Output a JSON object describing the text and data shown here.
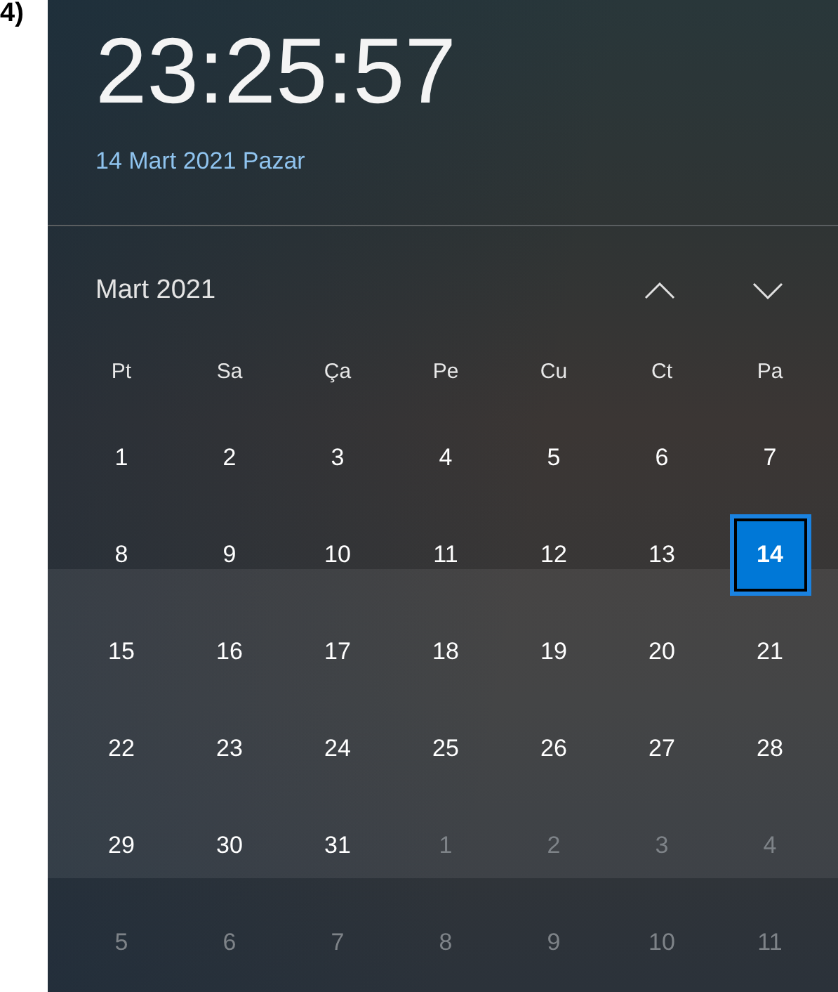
{
  "label": "4)",
  "clock": {
    "time": "23:25:57",
    "date": "14 Mart 2021 Pazar"
  },
  "calendar": {
    "month": "Mart 2021",
    "weekdays": [
      "Pt",
      "Sa",
      "Ça",
      "Pe",
      "Cu",
      "Ct",
      "Pa"
    ],
    "days": [
      {
        "day": "1",
        "in_month": true,
        "selected": false
      },
      {
        "day": "2",
        "in_month": true,
        "selected": false
      },
      {
        "day": "3",
        "in_month": true,
        "selected": false
      },
      {
        "day": "4",
        "in_month": true,
        "selected": false
      },
      {
        "day": "5",
        "in_month": true,
        "selected": false
      },
      {
        "day": "6",
        "in_month": true,
        "selected": false
      },
      {
        "day": "7",
        "in_month": true,
        "selected": false
      },
      {
        "day": "8",
        "in_month": true,
        "selected": false
      },
      {
        "day": "9",
        "in_month": true,
        "selected": false
      },
      {
        "day": "10",
        "in_month": true,
        "selected": false
      },
      {
        "day": "11",
        "in_month": true,
        "selected": false
      },
      {
        "day": "12",
        "in_month": true,
        "selected": false
      },
      {
        "day": "13",
        "in_month": true,
        "selected": false
      },
      {
        "day": "14",
        "in_month": true,
        "selected": true
      },
      {
        "day": "15",
        "in_month": true,
        "selected": false
      },
      {
        "day": "16",
        "in_month": true,
        "selected": false
      },
      {
        "day": "17",
        "in_month": true,
        "selected": false
      },
      {
        "day": "18",
        "in_month": true,
        "selected": false
      },
      {
        "day": "19",
        "in_month": true,
        "selected": false
      },
      {
        "day": "20",
        "in_month": true,
        "selected": false
      },
      {
        "day": "21",
        "in_month": true,
        "selected": false
      },
      {
        "day": "22",
        "in_month": true,
        "selected": false
      },
      {
        "day": "23",
        "in_month": true,
        "selected": false
      },
      {
        "day": "24",
        "in_month": true,
        "selected": false
      },
      {
        "day": "25",
        "in_month": true,
        "selected": false
      },
      {
        "day": "26",
        "in_month": true,
        "selected": false
      },
      {
        "day": "27",
        "in_month": true,
        "selected": false
      },
      {
        "day": "28",
        "in_month": true,
        "selected": false
      },
      {
        "day": "29",
        "in_month": true,
        "selected": false
      },
      {
        "day": "30",
        "in_month": true,
        "selected": false
      },
      {
        "day": "31",
        "in_month": true,
        "selected": false
      },
      {
        "day": "1",
        "in_month": false,
        "selected": false
      },
      {
        "day": "2",
        "in_month": false,
        "selected": false
      },
      {
        "day": "3",
        "in_month": false,
        "selected": false
      },
      {
        "day": "4",
        "in_month": false,
        "selected": false
      },
      {
        "day": "5",
        "in_month": false,
        "selected": false
      },
      {
        "day": "6",
        "in_month": false,
        "selected": false
      },
      {
        "day": "7",
        "in_month": false,
        "selected": false
      },
      {
        "day": "8",
        "in_month": false,
        "selected": false
      },
      {
        "day": "9",
        "in_month": false,
        "selected": false
      },
      {
        "day": "10",
        "in_month": false,
        "selected": false
      },
      {
        "day": "11",
        "in_month": false,
        "selected": false
      }
    ]
  }
}
